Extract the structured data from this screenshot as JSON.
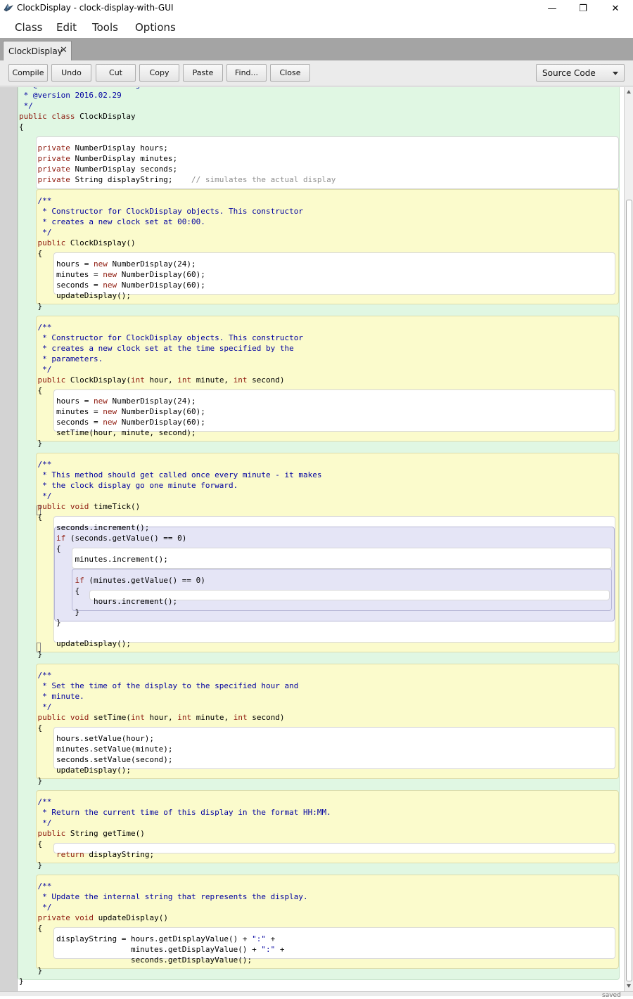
{
  "window": {
    "title": "ClockDisplay - clock-display-with-GUI",
    "minimize_glyph": "—",
    "restore_glyph": "❐",
    "close_glyph": "✕",
    "icon": "bluej-bird-icon"
  },
  "menu": [
    "Class",
    "Edit",
    "Tools",
    "Options"
  ],
  "tab": {
    "label": "ClockDisplay",
    "close_glyph": "✕"
  },
  "toolbar": {
    "buttons": [
      "Compile",
      "Undo",
      "Cut",
      "Copy",
      "Paste",
      "Find...",
      "Close"
    ],
    "view_select": "Source Code"
  },
  "status": {
    "text": "saved"
  },
  "colors": {
    "keyword": "#8e1a0e",
    "comment": "#0000a0",
    "class_scope": "#e0f7e3",
    "method_scope": "#fbfbcc",
    "if_scope": "#e5e5f6"
  },
  "code": [
    [
      {
        "t": " * @author Michael Kölling and David J. Barnes",
        "c": "cm"
      }
    ],
    [
      {
        "t": " * @version 2016.02.29",
        "c": "cm"
      }
    ],
    [
      {
        "t": " */",
        "c": "cm"
      }
    ],
    [
      {
        "t": "public",
        "c": "kw"
      },
      {
        "t": " "
      },
      {
        "t": "class",
        "c": "kw"
      },
      {
        "t": " ClockDisplay"
      }
    ],
    [
      {
        "t": "{"
      }
    ],
    [
      {
        "t": ""
      }
    ],
    [
      {
        "t": "    "
      },
      {
        "t": "private",
        "c": "kw"
      },
      {
        "t": " NumberDisplay hours;"
      }
    ],
    [
      {
        "t": "    "
      },
      {
        "t": "private",
        "c": "kw"
      },
      {
        "t": " NumberDisplay minutes;"
      }
    ],
    [
      {
        "t": "    "
      },
      {
        "t": "private",
        "c": "kw"
      },
      {
        "t": " NumberDisplay seconds;"
      }
    ],
    [
      {
        "t": "    "
      },
      {
        "t": "private",
        "c": "kw"
      },
      {
        "t": " String displayString;    "
      },
      {
        "t": "// simulates the actual display",
        "c": "lc"
      }
    ],
    [
      {
        "t": ""
      }
    ],
    [
      {
        "t": "    /**",
        "c": "cm"
      }
    ],
    [
      {
        "t": "     * Constructor for ClockDisplay objects. This constructor",
        "c": "cm"
      }
    ],
    [
      {
        "t": "     * creates a new clock set at 00:00.",
        "c": "cm"
      }
    ],
    [
      {
        "t": "     */",
        "c": "cm"
      }
    ],
    [
      {
        "t": "    "
      },
      {
        "t": "public",
        "c": "kw"
      },
      {
        "t": " ClockDisplay()"
      }
    ],
    [
      {
        "t": "    {"
      }
    ],
    [
      {
        "t": "        hours = "
      },
      {
        "t": "new",
        "c": "kw"
      },
      {
        "t": " NumberDisplay(24);"
      }
    ],
    [
      {
        "t": "        minutes = "
      },
      {
        "t": "new",
        "c": "kw"
      },
      {
        "t": " NumberDisplay(60);"
      }
    ],
    [
      {
        "t": "        seconds = "
      },
      {
        "t": "new",
        "c": "kw"
      },
      {
        "t": " NumberDisplay(60);"
      }
    ],
    [
      {
        "t": "        updateDisplay();"
      }
    ],
    [
      {
        "t": "    }"
      }
    ],
    [
      {
        "t": ""
      }
    ],
    [
      {
        "t": "    /**",
        "c": "cm"
      }
    ],
    [
      {
        "t": "     * Constructor for ClockDisplay objects. This constructor",
        "c": "cm"
      }
    ],
    [
      {
        "t": "     * creates a new clock set at the time specified by the",
        "c": "cm"
      }
    ],
    [
      {
        "t": "     * parameters.",
        "c": "cm"
      }
    ],
    [
      {
        "t": "     */",
        "c": "cm"
      }
    ],
    [
      {
        "t": "    "
      },
      {
        "t": "public",
        "c": "kw"
      },
      {
        "t": " ClockDisplay("
      },
      {
        "t": "int",
        "c": "kw"
      },
      {
        "t": " hour, "
      },
      {
        "t": "int",
        "c": "kw"
      },
      {
        "t": " minute, "
      },
      {
        "t": "int",
        "c": "kw"
      },
      {
        "t": " second)"
      }
    ],
    [
      {
        "t": "    {"
      }
    ],
    [
      {
        "t": "        hours = "
      },
      {
        "t": "new",
        "c": "kw"
      },
      {
        "t": " NumberDisplay(24);"
      }
    ],
    [
      {
        "t": "        minutes = "
      },
      {
        "t": "new",
        "c": "kw"
      },
      {
        "t": " NumberDisplay(60);"
      }
    ],
    [
      {
        "t": "        seconds = "
      },
      {
        "t": "new",
        "c": "kw"
      },
      {
        "t": " NumberDisplay(60);"
      }
    ],
    [
      {
        "t": "        setTime(hour, minute, second);"
      }
    ],
    [
      {
        "t": "    }"
      }
    ],
    [
      {
        "t": ""
      }
    ],
    [
      {
        "t": "    /**",
        "c": "cm"
      }
    ],
    [
      {
        "t": "     * This method should get called once every minute - it makes",
        "c": "cm"
      }
    ],
    [
      {
        "t": "     * the clock display go one minute forward.",
        "c": "cm"
      }
    ],
    [
      {
        "t": "     */",
        "c": "cm"
      }
    ],
    [
      {
        "t": "    "
      },
      {
        "t": "public",
        "c": "kw"
      },
      {
        "t": " "
      },
      {
        "t": "void",
        "c": "kw"
      },
      {
        "t": " timeTick()"
      }
    ],
    [
      {
        "t": "    {"
      }
    ],
    [
      {
        "t": "        seconds.increment();"
      }
    ],
    [
      {
        "t": "        "
      },
      {
        "t": "if",
        "c": "kw"
      },
      {
        "t": " (seconds.getValue() == 0)"
      }
    ],
    [
      {
        "t": "        {"
      }
    ],
    [
      {
        "t": "            minutes.increment();"
      }
    ],
    [
      {
        "t": ""
      }
    ],
    [
      {
        "t": "            "
      },
      {
        "t": "if",
        "c": "kw"
      },
      {
        "t": " (minutes.getValue() == 0)"
      }
    ],
    [
      {
        "t": "            {"
      }
    ],
    [
      {
        "t": "                hours.increment();"
      }
    ],
    [
      {
        "t": "            }"
      }
    ],
    [
      {
        "t": "        }"
      }
    ],
    [
      {
        "t": ""
      }
    ],
    [
      {
        "t": "        updateDisplay();"
      }
    ],
    [
      {
        "t": "    }"
      }
    ],
    [
      {
        "t": ""
      }
    ],
    [
      {
        "t": "    /**",
        "c": "cm"
      }
    ],
    [
      {
        "t": "     * Set the time of the display to the specified hour and",
        "c": "cm"
      }
    ],
    [
      {
        "t": "     * minute.",
        "c": "cm"
      }
    ],
    [
      {
        "t": "     */",
        "c": "cm"
      }
    ],
    [
      {
        "t": "    "
      },
      {
        "t": "public",
        "c": "kw"
      },
      {
        "t": " "
      },
      {
        "t": "void",
        "c": "kw"
      },
      {
        "t": " setTime("
      },
      {
        "t": "int",
        "c": "kw"
      },
      {
        "t": " hour, "
      },
      {
        "t": "int",
        "c": "kw"
      },
      {
        "t": " minute, "
      },
      {
        "t": "int",
        "c": "kw"
      },
      {
        "t": " second)"
      }
    ],
    [
      {
        "t": "    {"
      }
    ],
    [
      {
        "t": "        hours.setValue(hour);"
      }
    ],
    [
      {
        "t": "        minutes.setValue(minute);"
      }
    ],
    [
      {
        "t": "        seconds.setValue(second);"
      }
    ],
    [
      {
        "t": "        updateDisplay();"
      }
    ],
    [
      {
        "t": "    }"
      }
    ],
    [
      {
        "t": ""
      }
    ],
    [
      {
        "t": "    /**",
        "c": "cm"
      }
    ],
    [
      {
        "t": "     * Return the current time of this display in the format HH:MM.",
        "c": "cm"
      }
    ],
    [
      {
        "t": "     */",
        "c": "cm"
      }
    ],
    [
      {
        "t": "    "
      },
      {
        "t": "public",
        "c": "kw"
      },
      {
        "t": " String getTime()"
      }
    ],
    [
      {
        "t": "    {"
      }
    ],
    [
      {
        "t": "        "
      },
      {
        "t": "return",
        "c": "kw"
      },
      {
        "t": " displayString;"
      }
    ],
    [
      {
        "t": "    }"
      }
    ],
    [
      {
        "t": ""
      }
    ],
    [
      {
        "t": "    /**",
        "c": "cm"
      }
    ],
    [
      {
        "t": "     * Update the internal string that represents the display.",
        "c": "cm"
      }
    ],
    [
      {
        "t": "     */",
        "c": "cm"
      }
    ],
    [
      {
        "t": "    "
      },
      {
        "t": "private",
        "c": "kw"
      },
      {
        "t": " "
      },
      {
        "t": "void",
        "c": "kw"
      },
      {
        "t": " updateDisplay()"
      }
    ],
    [
      {
        "t": "    {"
      }
    ],
    [
      {
        "t": "        displayString = hours.getDisplayValue() + "
      },
      {
        "t": "\":\"",
        "c": "st"
      },
      {
        "t": " +"
      }
    ],
    [
      {
        "t": "                        minutes.getDisplayValue() + "
      },
      {
        "t": "\":\"",
        "c": "st"
      },
      {
        "t": " +"
      }
    ],
    [
      {
        "t": "                        seconds.getDisplayValue();"
      }
    ],
    [
      {
        "t": "    }"
      }
    ],
    [
      {
        "t": "}"
      }
    ]
  ]
}
